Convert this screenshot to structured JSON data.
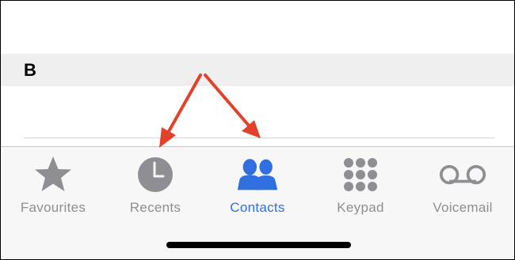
{
  "list": {
    "section_letter": "B"
  },
  "tabbar": {
    "tabs": [
      {
        "label": "Favourites",
        "icon": "star-icon",
        "active": false
      },
      {
        "label": "Recents",
        "icon": "clock-icon",
        "active": false
      },
      {
        "label": "Contacts",
        "icon": "contacts-icon",
        "active": true
      },
      {
        "label": "Keypad",
        "icon": "keypad-icon",
        "active": false
      },
      {
        "label": "Voicemail",
        "icon": "voicemail-icon",
        "active": false
      }
    ]
  },
  "colors": {
    "active_tab": "#2f6fe0",
    "inactive_tab": "#8e8e93",
    "annotation_arrow": "#e2412b"
  }
}
